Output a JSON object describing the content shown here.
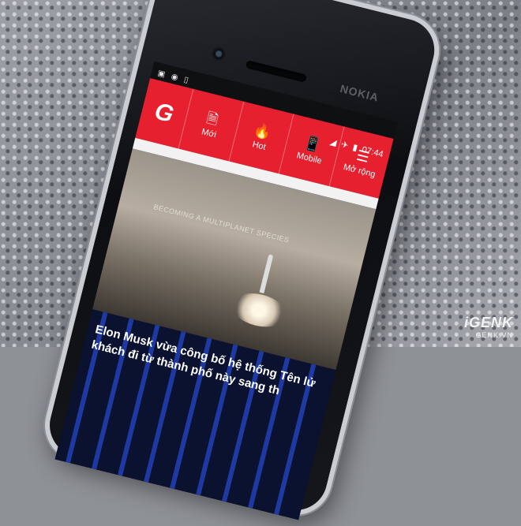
{
  "app": {
    "logo": "G",
    "tabs": [
      {
        "label": "Mới",
        "icon": "document-icon",
        "glyph": "🗎"
      },
      {
        "label": "Hot",
        "icon": "flame-icon",
        "glyph": "🔥"
      },
      {
        "label": "Mobile",
        "icon": "phone-icon",
        "glyph": "📱"
      },
      {
        "label": "Mở rộng",
        "icon": "menu-icon",
        "glyph": "☰"
      }
    ],
    "accent": "#e6202e"
  },
  "status": {
    "time": "07:44"
  },
  "device": {
    "brand": "NOKIA"
  },
  "article": {
    "hero_caption": "BECOMING A MULTIPLANET SPECIES",
    "headline_line1": "Elon Musk vừa công bố hệ thống Tên lử",
    "headline_line2": "khách đi từ thành phố này sang th"
  },
  "watermark": {
    "brand": "iGENK",
    "site": "GENK.VN"
  }
}
